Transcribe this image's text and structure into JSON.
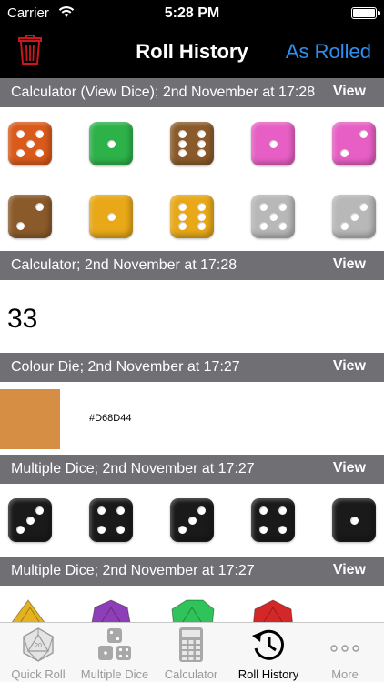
{
  "status": {
    "carrier": "Carrier",
    "time": "5:28 PM"
  },
  "nav": {
    "title": "Roll History",
    "right_button": "As Rolled"
  },
  "colors": {
    "accent": "#2F8FF0",
    "trash": "#C8181E",
    "header_bg": "#6F6F74"
  },
  "sections": [
    {
      "title": "Calculator (View Dice); 2nd November at 17:28",
      "view": "View",
      "dice": [
        {
          "color": "#D95A1A",
          "value": 5
        },
        {
          "color": "#2DB24A",
          "value": 1
        },
        {
          "color": "#8B5A2B",
          "value": 6
        },
        {
          "color": "#E75FC4",
          "value": 1
        },
        {
          "color": "#E75FC4",
          "value": 2
        },
        {
          "color": "#8B5A2B",
          "value": 2
        },
        {
          "color": "#E8A817",
          "value": 1
        },
        {
          "color": "#E8A817",
          "value": 6
        },
        {
          "color": "#B8B8B8",
          "value": 5
        },
        {
          "color": "#B8B8B8",
          "value": 3
        }
      ]
    },
    {
      "title": "Calculator; 2nd November at 17:28",
      "view": "View",
      "result": "33"
    },
    {
      "title": "Colour Die; 2nd November at 17:27",
      "view": "View",
      "colour": "#D68D44",
      "hex_label": "#D68D44"
    },
    {
      "title": "Multiple Dice; 2nd November at 17:27",
      "view": "View",
      "dice": [
        {
          "color": "#1A1A1A",
          "value": 3
        },
        {
          "color": "#1A1A1A",
          "value": 4
        },
        {
          "color": "#1A1A1A",
          "value": 3
        },
        {
          "color": "#1A1A1A",
          "value": 4
        },
        {
          "color": "#1A1A1A",
          "value": 1
        }
      ]
    },
    {
      "title": "Multiple Dice; 2nd November at 17:27",
      "view": "View",
      "polyhedra": [
        {
          "color": "#E3B21E"
        },
        {
          "color": "#8E3FB8"
        },
        {
          "color": "#2FC35A"
        },
        {
          "color": "#D42828"
        }
      ]
    }
  ],
  "tabs": [
    {
      "label": "Quick Roll",
      "icon": "d20-icon",
      "active": false
    },
    {
      "label": "Multiple Dice",
      "icon": "dice-icon",
      "active": false
    },
    {
      "label": "Calculator",
      "icon": "calculator-icon",
      "active": false
    },
    {
      "label": "Roll History",
      "icon": "history-icon",
      "active": true
    },
    {
      "label": "More",
      "icon": "more-icon",
      "active": false
    }
  ]
}
